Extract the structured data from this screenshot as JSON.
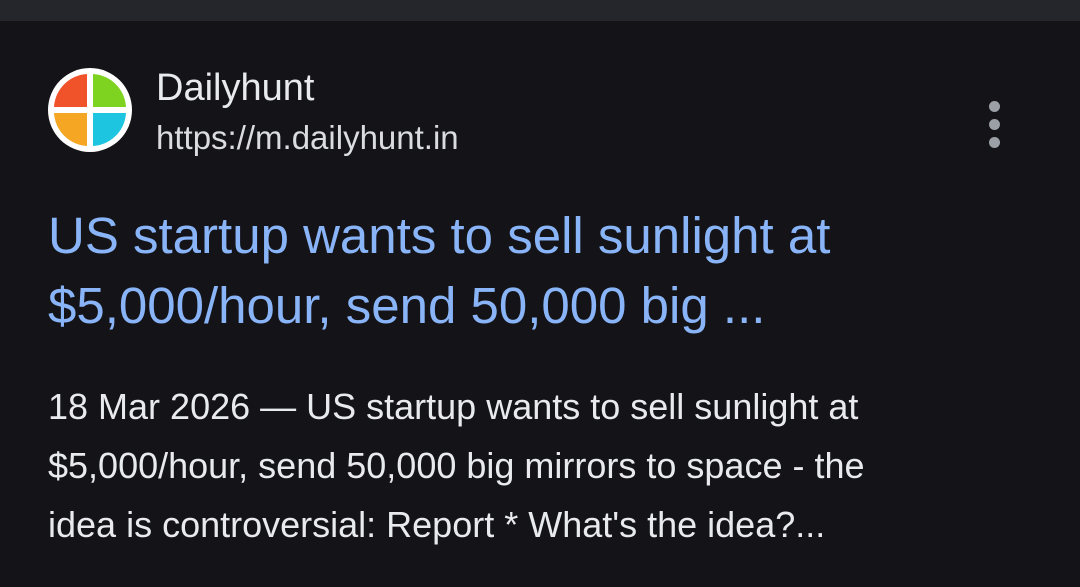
{
  "result": {
    "site_name": "Dailyhunt",
    "site_url": "https://m.dailyhunt.in",
    "favicon_icon": "dailyhunt-logo-icon",
    "favicon_colors": [
      "#f0522a",
      "#7ed321",
      "#f5a623",
      "#1ec5e0"
    ],
    "more_options_icon": "more-vert-icon",
    "title_lines": [
      "US startup wants to sell sunlight at",
      "$5,000/hour, send 50,000 big ..."
    ],
    "snippet_lines": [
      "18 Mar 2026 — US startup wants to sell sunlight at",
      "$5,000/hour, send 50,000 big mirrors to space - the",
      "idea is controversial: Report * What's the idea?..."
    ]
  },
  "colors": {
    "background": "#141418",
    "divider": "#25262b",
    "link": "#8ab4f8",
    "text": "#e8eaed",
    "icon": "#9aa0a6"
  }
}
